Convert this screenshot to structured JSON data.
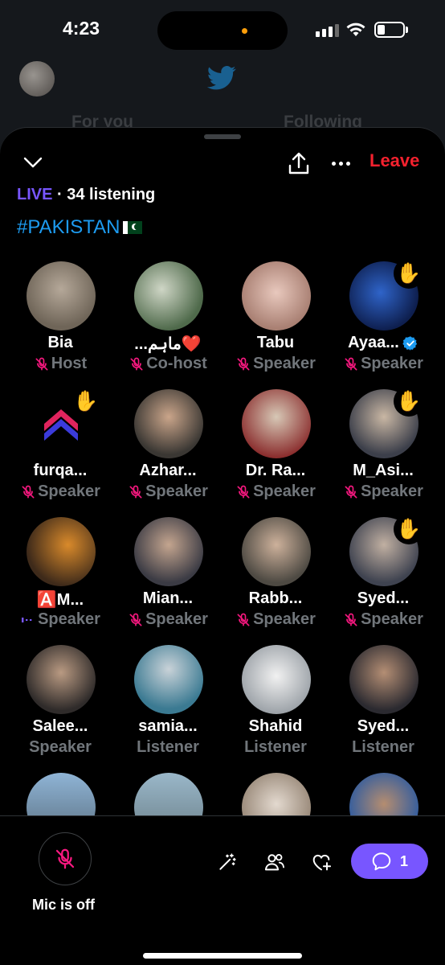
{
  "status_bar": {
    "time": "4:23"
  },
  "background": {
    "tabs": [
      "For you",
      "Following"
    ]
  },
  "header": {
    "leave_label": "Leave",
    "live_tag": "LIVE",
    "listening": "· 34 listening"
  },
  "space": {
    "title": "#PAKISTAN"
  },
  "participants": [
    {
      "name": "Bia",
      "role": "Host",
      "muted": true,
      "hand": false,
      "verified": false
    },
    {
      "name": "...ماہم❤️",
      "role": "Co-host",
      "muted": true,
      "hand": false,
      "verified": false
    },
    {
      "name": "Tabu",
      "role": "Speaker",
      "muted": true,
      "hand": false,
      "verified": false
    },
    {
      "name": "Ayaa...",
      "role": "Speaker",
      "muted": true,
      "hand": true,
      "verified": true
    },
    {
      "name": "furqa...",
      "role": "Speaker",
      "muted": true,
      "hand": true,
      "verified": false
    },
    {
      "name": "Azhar...",
      "role": "Speaker",
      "muted": true,
      "hand": false,
      "verified": false
    },
    {
      "name": "Dr. Ra...",
      "role": "Speaker",
      "muted": true,
      "hand": false,
      "verified": false
    },
    {
      "name": "M_Asi...",
      "role": "Speaker",
      "muted": true,
      "hand": true,
      "verified": false
    },
    {
      "name": "🅰️M...",
      "role": "Speaker",
      "muted": false,
      "talking": true,
      "hand": false,
      "verified": false
    },
    {
      "name": "Mian...",
      "role": "Speaker",
      "muted": true,
      "hand": false,
      "verified": false
    },
    {
      "name": "Rabb...",
      "role": "Speaker",
      "muted": true,
      "hand": false,
      "verified": false
    },
    {
      "name": "Syed...",
      "role": "Speaker",
      "muted": true,
      "hand": true,
      "verified": false
    },
    {
      "name": "Salee...",
      "role": "Speaker",
      "muted": false,
      "hand": false,
      "verified": false
    },
    {
      "name": "samia...",
      "role": "Listener",
      "muted": false,
      "hand": false,
      "verified": false
    },
    {
      "name": "Shahid",
      "role": "Listener",
      "muted": false,
      "hand": false,
      "verified": false
    },
    {
      "name": "Syed...",
      "role": "Listener",
      "muted": false,
      "hand": false,
      "verified": false
    }
  ],
  "bottom_bar": {
    "mic_label": "Mic is off",
    "comment_count": "1"
  },
  "colors": {
    "accent_purple": "#7856ff",
    "leave_red": "#f4212e",
    "mute_pink": "#f91880",
    "link_blue": "#1d9bf0",
    "secondary_text": "#71767b"
  },
  "icons": {
    "collapse": "chevron-down-icon",
    "share": "share-icon",
    "more": "more-icon",
    "raise_hand": "raised-hand-icon",
    "muted": "mic-muted-icon",
    "speaking": "sound-wave-icon",
    "verified": "verified-badge-icon",
    "effects": "magic-wand-icon",
    "people": "people-icon",
    "react": "heart-plus-icon",
    "comment": "comment-icon"
  }
}
